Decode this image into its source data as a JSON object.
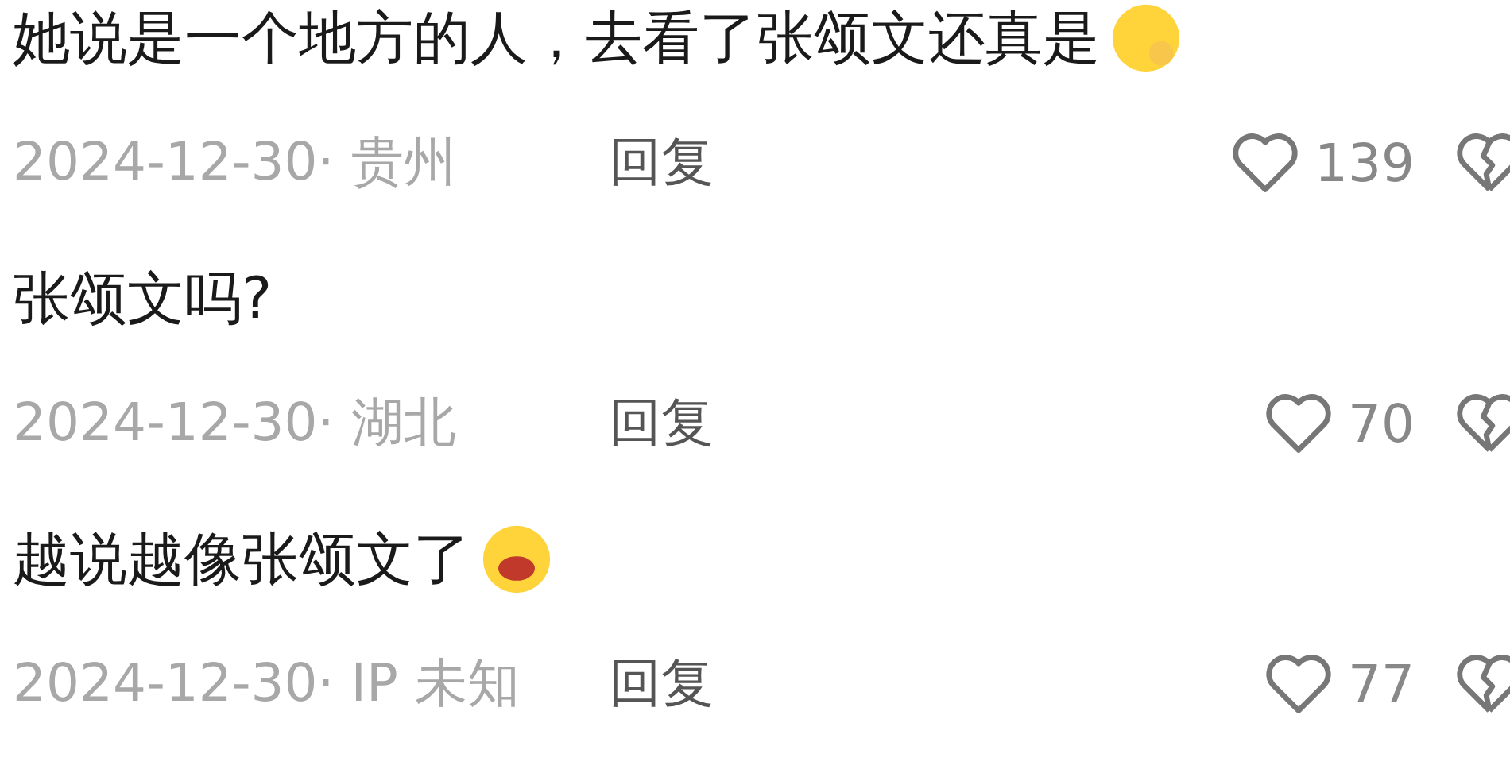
{
  "comments": [
    {
      "text": "她说是一个地方的人，去看了张颂文还真是",
      "emoji": true,
      "meta": "2024-12-30· 贵州",
      "reply": "回复",
      "likes": "139"
    },
    {
      "text": "张颂文吗?",
      "emoji": false,
      "meta": "2024-12-30· 湖北",
      "reply": "回复",
      "likes": "70"
    },
    {
      "text": "越说越像张颂文了",
      "emoji": true,
      "meta": "2024-12-30· IP 未知",
      "reply": "回复",
      "likes": "77"
    }
  ]
}
